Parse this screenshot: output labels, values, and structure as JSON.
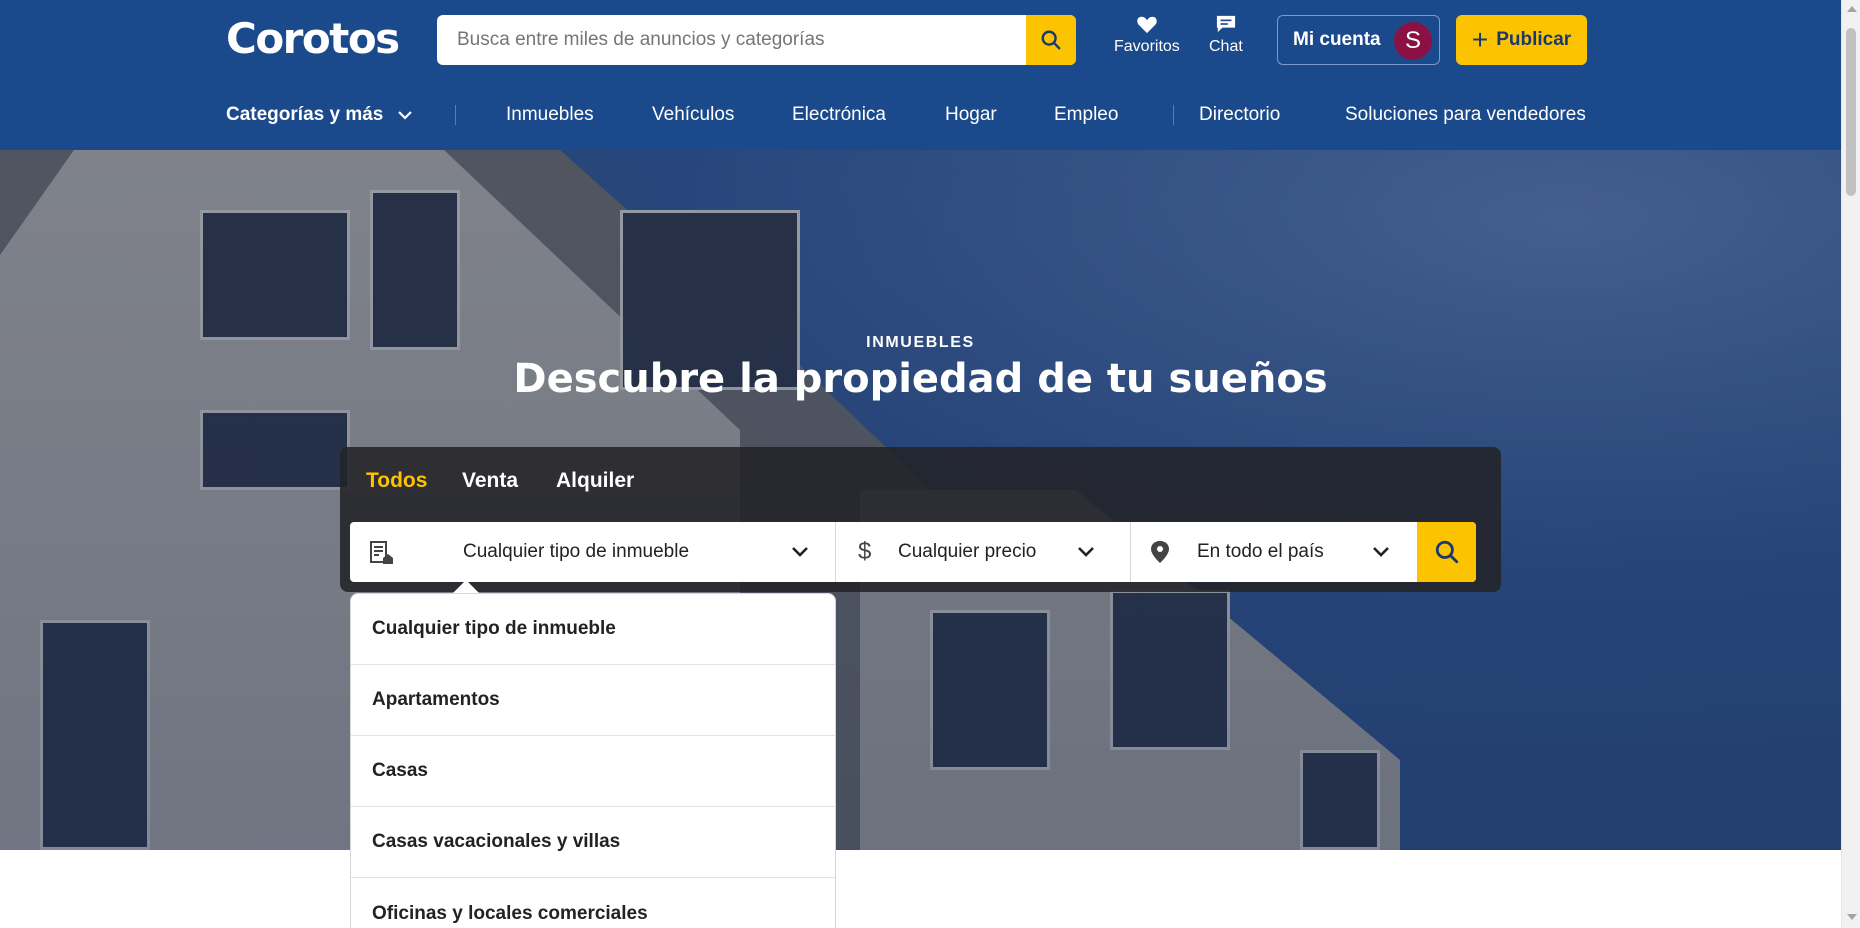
{
  "header": {
    "logo": "Corotos",
    "search_placeholder": "Busca entre miles de anuncios y categorías",
    "favorites_label": "Favoritos",
    "chat_label": "Chat",
    "account_label": "Mi cuenta",
    "avatar_initial": "S",
    "publish_label": "Publicar"
  },
  "nav": {
    "categories_label": "Categorías y más",
    "items": [
      "Inmuebles",
      "Vehículos",
      "Electrónica",
      "Hogar",
      "Empleo"
    ],
    "directory_label": "Directorio",
    "sellers_label": "Soluciones para vendedores"
  },
  "hero": {
    "kicker": "INMUEBLES",
    "title": "Descubre la propiedad de tu sueños"
  },
  "search_panel": {
    "tabs": [
      "Todos",
      "Venta",
      "Alquiler"
    ],
    "active_tab": "Todos",
    "filters": {
      "type": "Cualquier tipo de inmueble",
      "price": "Cualquier precio",
      "location": "En todo el país"
    }
  },
  "dropdown": {
    "options": [
      "Cualquier tipo de inmueble",
      "Apartamentos",
      "Casas",
      "Casas vacacionales y villas",
      "Oficinas y locales comerciales"
    ]
  },
  "colors": {
    "brand_blue": "#1b4a8c",
    "accent_yellow": "#fcc400",
    "avatar": "#8b1043"
  }
}
